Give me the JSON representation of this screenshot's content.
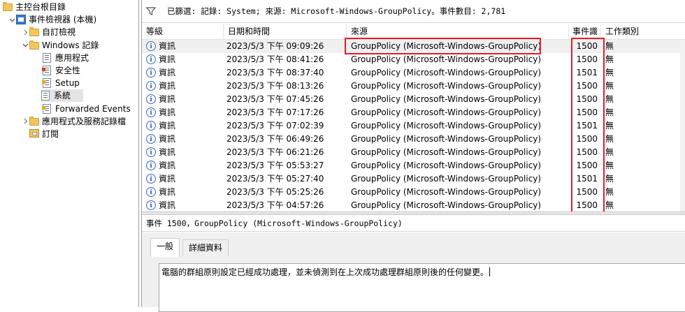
{
  "tree": {
    "items": [
      {
        "label": "主控台根目錄",
        "indent": 0,
        "arrow": "",
        "icon": "folder-icon"
      },
      {
        "label": "事件檢視器 (本機)",
        "indent": 1,
        "arrow": "down",
        "icon": "event-viewer-icon"
      },
      {
        "label": "自訂檢視",
        "indent": 2,
        "arrow": "right",
        "icon": "folder-icon"
      },
      {
        "label": "Windows 記錄",
        "indent": 2,
        "arrow": "down",
        "icon": "folder-icon"
      },
      {
        "label": "應用程式",
        "indent": 3,
        "arrow": "",
        "icon": "log-icon"
      },
      {
        "label": "安全性",
        "indent": 3,
        "arrow": "",
        "icon": "log-icon"
      },
      {
        "label": "Setup",
        "indent": 3,
        "arrow": "",
        "icon": "log-icon"
      },
      {
        "label": "系統",
        "indent": 3,
        "arrow": "",
        "icon": "log-icon",
        "selected": true
      },
      {
        "label": "Forwarded Events",
        "indent": 3,
        "arrow": "",
        "icon": "log-icon"
      },
      {
        "label": "應用程式及服務記錄檔",
        "indent": 2,
        "arrow": "right",
        "icon": "folder-icon"
      },
      {
        "label": "訂閱",
        "indent": 2,
        "arrow": "",
        "icon": "subscription-icon"
      }
    ]
  },
  "filter": {
    "text": "已篩選: 記錄: System; 來源: Microsoft-Windows-GroupPolicy。事件數目: 2,781"
  },
  "columns": {
    "level": "等級",
    "date": "日期和時間",
    "source": "來源",
    "event_id": "事件識別碼",
    "task": "工作類別"
  },
  "events": [
    {
      "level": "資訊",
      "date": "2023/5/3 下午 09:09:26",
      "source": "GroupPolicy (Microsoft-Windows-GroupPolicy)",
      "id": "1500",
      "task": "無"
    },
    {
      "level": "資訊",
      "date": "2023/5/3 下午 08:41:26",
      "source": "GroupPolicy (Microsoft-Windows-GroupPolicy)",
      "id": "1500",
      "task": "無"
    },
    {
      "level": "資訊",
      "date": "2023/5/3 下午 08:37:40",
      "source": "GroupPolicy (Microsoft-Windows-GroupPolicy)",
      "id": "1501",
      "task": "無"
    },
    {
      "level": "資訊",
      "date": "2023/5/3 下午 08:13:26",
      "source": "GroupPolicy (Microsoft-Windows-GroupPolicy)",
      "id": "1500",
      "task": "無"
    },
    {
      "level": "資訊",
      "date": "2023/5/3 下午 07:45:26",
      "source": "GroupPolicy (Microsoft-Windows-GroupPolicy)",
      "id": "1500",
      "task": "無"
    },
    {
      "level": "資訊",
      "date": "2023/5/3 下午 07:17:26",
      "source": "GroupPolicy (Microsoft-Windows-GroupPolicy)",
      "id": "1500",
      "task": "無"
    },
    {
      "level": "資訊",
      "date": "2023/5/3 下午 07:02:39",
      "source": "GroupPolicy (Microsoft-Windows-GroupPolicy)",
      "id": "1501",
      "task": "無"
    },
    {
      "level": "資訊",
      "date": "2023/5/3 下午 06:49:26",
      "source": "GroupPolicy (Microsoft-Windows-GroupPolicy)",
      "id": "1500",
      "task": "無"
    },
    {
      "level": "資訊",
      "date": "2023/5/3 下午 06:21:26",
      "source": "GroupPolicy (Microsoft-Windows-GroupPolicy)",
      "id": "1500",
      "task": "無"
    },
    {
      "level": "資訊",
      "date": "2023/5/3 下午 05:53:27",
      "source": "GroupPolicy (Microsoft-Windows-GroupPolicy)",
      "id": "1500",
      "task": "無"
    },
    {
      "level": "資訊",
      "date": "2023/5/3 下午 05:27:40",
      "source": "GroupPolicy (Microsoft-Windows-GroupPolicy)",
      "id": "1501",
      "task": "無"
    },
    {
      "level": "資訊",
      "date": "2023/5/3 下午 05:25:26",
      "source": "GroupPolicy (Microsoft-Windows-GroupPolicy)",
      "id": "1500",
      "task": "無"
    },
    {
      "level": "資訊",
      "date": "2023/5/3 下午 04:57:26",
      "source": "GroupPolicy (Microsoft-Windows-GroupPolicy)",
      "id": "1500",
      "task": "無"
    }
  ],
  "detail": {
    "title": "事件 1500，GroupPolicy (Microsoft-Windows-GroupPolicy)",
    "tabs": [
      "一般",
      "詳細資料"
    ],
    "description": "電腦的群組原則設定已經成功處理，並未偵測到在上次成功處理群組原則後的任何變更。"
  },
  "colors": {
    "highlight": "#e0202a",
    "selected_row": "#f0f0f0"
  }
}
